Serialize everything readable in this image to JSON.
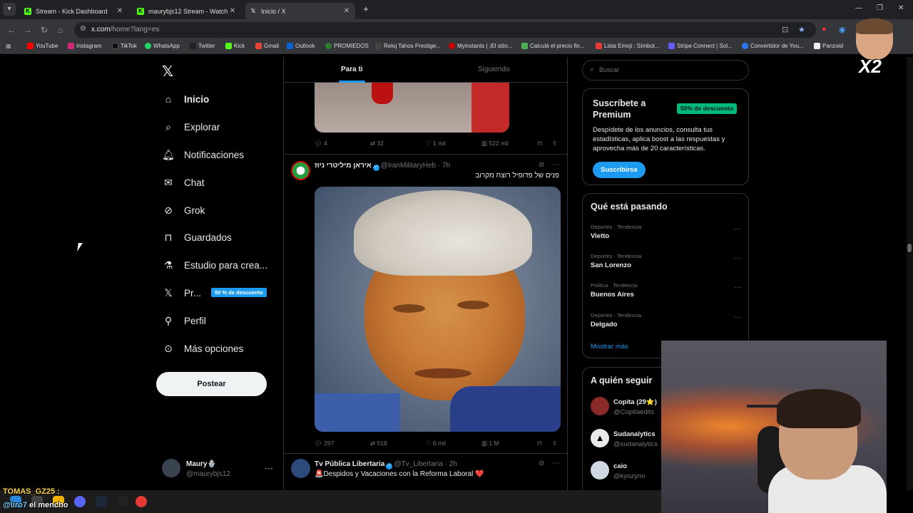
{
  "browser": {
    "tabs": [
      {
        "title": "Stream - Kick Dashboard",
        "active": false
      },
      {
        "title": "maurybjs12 Stream - Watch Live",
        "active": false
      },
      {
        "title": "Inicio / X",
        "active": true
      }
    ],
    "url_host": "x.com",
    "url_path": "/home?lang=es",
    "bookmarks": [
      "YouTube",
      "Instagram",
      "TikTok",
      "WhatsApp",
      "Twitter",
      "Kick",
      "Gmail",
      "Outlook",
      "PROMIEDOS",
      "Reloj Tahos Prestige...",
      "Myinstants | ¡El sitio...",
      "Calculá el precio fin...",
      "Lista Emoji : Símbol...",
      "Stripe Connect | Sol...",
      "Convertidor de You...",
      "Panzoid"
    ]
  },
  "nav": {
    "items": [
      {
        "label": "Inicio",
        "icon": "home-icon"
      },
      {
        "label": "Explorar",
        "icon": "search-icon"
      },
      {
        "label": "Notificaciones",
        "icon": "bell-icon"
      },
      {
        "label": "Chat",
        "icon": "mail-icon"
      },
      {
        "label": "Grok",
        "icon": "grok-icon"
      },
      {
        "label": "Guardados",
        "icon": "bookmark-icon"
      },
      {
        "label": "Estudio para crea...",
        "icon": "flask-icon"
      },
      {
        "label": "Pr...",
        "icon": "x-premium-icon"
      },
      {
        "label": "Perfil",
        "icon": "person-icon"
      },
      {
        "label": "Más opciones",
        "icon": "more-circle-icon"
      }
    ],
    "premium_badge": "50 % de descuento",
    "post_button": "Postear",
    "user": {
      "name": "Maury🪬",
      "handle": "@maurybjs12"
    }
  },
  "timeline": {
    "tabs": [
      "Para ti",
      "Siguiendo"
    ],
    "tweet0_actions": {
      "replies": "4",
      "reposts": "32",
      "likes": "1 mil",
      "views": "522 mil"
    },
    "tweet1": {
      "name": "איראן מיליטרי ניוז",
      "handle": "@IranMilitaryHeb",
      "time": "· 7h",
      "text": "פנים של פדופיל רוצח מקרוב",
      "actions": {
        "replies": "297",
        "reposts": "518",
        "likes": "6 mil",
        "views": "1 M"
      }
    },
    "tweet2": {
      "name": "Tv Pública Libertaria",
      "handle": "@Tv_Libertaria",
      "time": "· 2h",
      "text": "🚨Despidos y Vacaciones con la Reforma Laboral ❤️"
    }
  },
  "sidebar": {
    "search_placeholder": "Buscar",
    "premium": {
      "title": "Suscríbete a Premium",
      "badge": "50% de descuento",
      "desc": "Despídete de los anuncios, consulta tus estadísticas, aplica boost a las respuestas y aprovecha más de 20 características.",
      "button": "Suscribirse"
    },
    "trends_title": "Qué está pasando",
    "trends": [
      {
        "category": "Deportes · Tendencia",
        "title": "Vietto"
      },
      {
        "category": "Deportes · Tendencia",
        "title": "San Lorenzo"
      },
      {
        "category": "Política · Tendencia",
        "title": "Buenos Aires"
      },
      {
        "category": "Deportes · Tendencia",
        "title": "Delgado"
      }
    ],
    "show_more": "Mostrar más",
    "follow_title": "A quién seguir",
    "follow": [
      {
        "name": "Copita (29⭐)",
        "handle": "@Copitaedits"
      },
      {
        "name": "Sudanalytics",
        "handle": "@sudanalytics"
      },
      {
        "name": "caio",
        "handle": "@kyozynn"
      }
    ]
  },
  "overlay": {
    "chat_user1": "TOMAS_GZ25 :",
    "chat_user2": "@liro7",
    "chat_msg2": "el mencho",
    "emote_label": "X2"
  },
  "colors": {
    "accent": "#1d9bf0",
    "premium_green": "#00ba7c",
    "background": "#000000"
  }
}
